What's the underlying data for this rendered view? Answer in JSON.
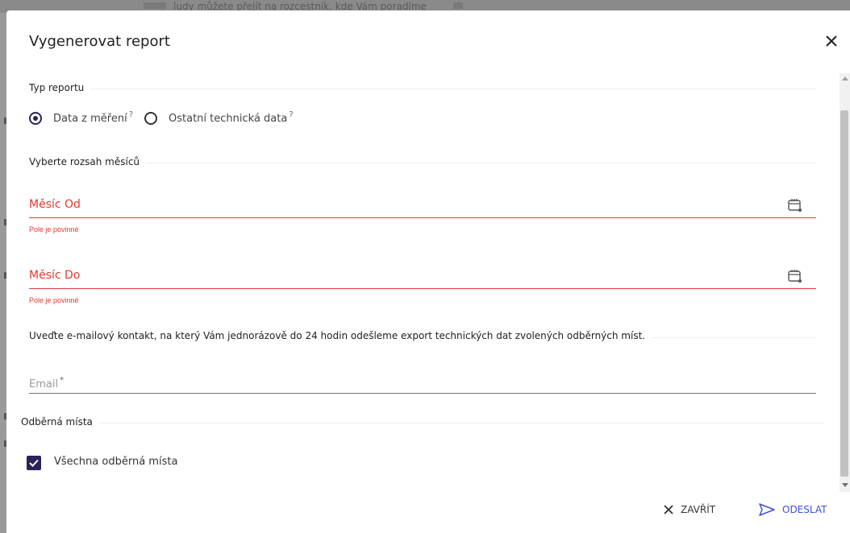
{
  "background": {
    "text": "ludy můžete přejít na rozcestník, kde Vám poradíme"
  },
  "dialog": {
    "title": "Vygenerovat report",
    "close_icon": "close-icon"
  },
  "report_type": {
    "label": "Typ reportu",
    "options": [
      {
        "label": "Data z měření",
        "hint": "?",
        "selected": true
      },
      {
        "label": "Ostatní technická data",
        "hint": "?",
        "selected": false
      }
    ]
  },
  "month_range": {
    "label": "Vyberte rozsah měsíců",
    "from": {
      "placeholder": "Měsíc Od",
      "error": "Pole je povinné",
      "icon": "calendar-icon"
    },
    "to": {
      "placeholder": "Měsíc Do",
      "error": "Pole je povinné",
      "icon": "calendar-icon"
    }
  },
  "email_section": {
    "info": "Uveďte e-mailový kontakt, na který Vám jednorázově do 24 hodin odešleme export technických dat zvolených odběrných míst.",
    "placeholder": "Email",
    "required_mark": "*"
  },
  "consumption_points": {
    "label": "Odběrná místa",
    "all_label": "Všechna odběrná místa",
    "all_checked": true
  },
  "actions": {
    "close_label": "ZAVŘÍT",
    "send_label": "ODESLAT"
  },
  "colors": {
    "accent": "#2b2257",
    "error": "#e53935",
    "link": "#3d4fe0"
  }
}
